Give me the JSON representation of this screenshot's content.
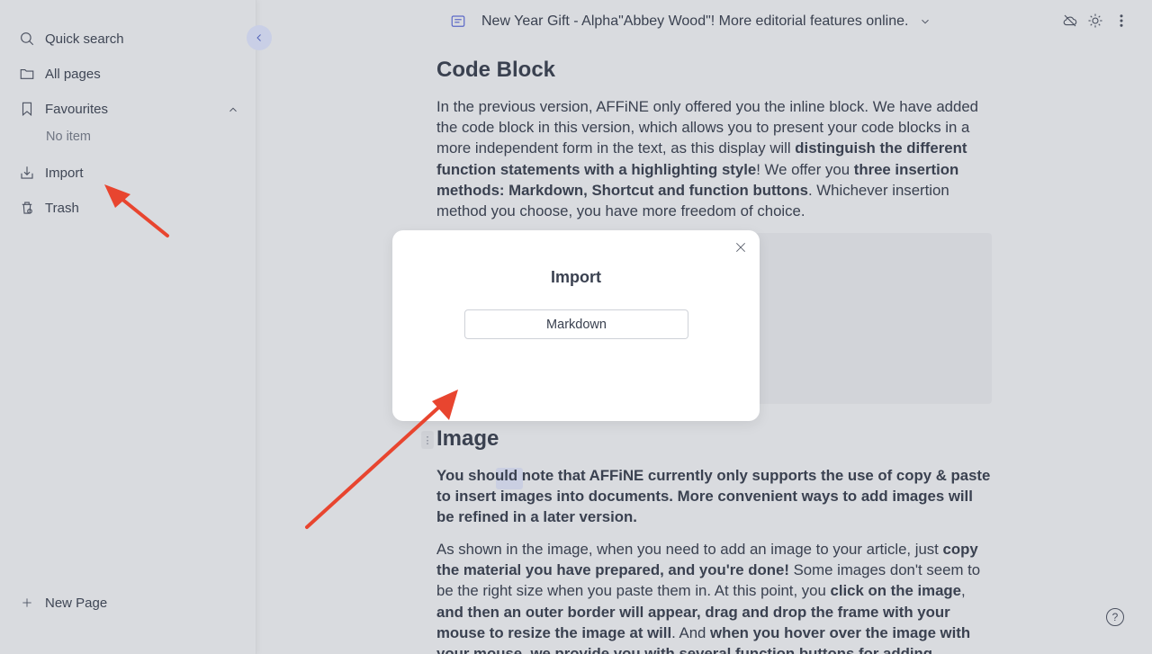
{
  "sidebar": {
    "items": [
      {
        "label": "Quick search",
        "icon": "search-icon"
      },
      {
        "label": "All pages",
        "icon": "folder-icon"
      },
      {
        "label": "Favourites",
        "icon": "bookmark-icon"
      },
      {
        "label": "Import",
        "icon": "import-icon"
      },
      {
        "label": "Trash",
        "icon": "trash-icon"
      }
    ],
    "favourites_empty": "No item",
    "new_page_label": "New Page"
  },
  "header": {
    "doc_title": "New Year Gift - Alpha\"Abbey Wood\"! More editorial features online."
  },
  "content": {
    "code_block_heading": "Code Block",
    "p1": {
      "a": "In the previous version, AFFiNE only offered you the inline block. We have added the code block in this version, which allows you to present your code blocks in a more independent form in the text, as this display will ",
      "b": "distinguish the different function statements with a highlighting style",
      "c": "! We offer you ",
      "d": "three insertion methods: Markdown, Shortcut and function buttons",
      "e": ". Whichever insertion method you choose, you have more freedom of choice."
    },
    "image_heading": "Image",
    "p2": "You should note that AFFiNE currently only supports the use of copy & paste to insert images into documents. More convenient ways to add images will be refined in a later version.",
    "p3": {
      "a": "As shown in the image, when you need to add an image to your article, just ",
      "b": "copy the material you have prepared, and you're done!",
      "c": " Some images don't seem to be the right size when you paste them in. At this point, you ",
      "d": "click on the image",
      "e": ", ",
      "f": "and then an outer border will appear, drag and drop the frame with your mouse to resize the image at will",
      "g": ". And ",
      "h": "when you hover over the image with your mouse, we provide you with several function buttons for adding captions, copying, downloading, and"
    }
  },
  "modal": {
    "title": "Import",
    "button_label": "Markdown"
  },
  "help_label": "?",
  "colors": {
    "background": "#d9dbdf",
    "accent": "#5b68c7",
    "arrow": "#e8452f"
  }
}
